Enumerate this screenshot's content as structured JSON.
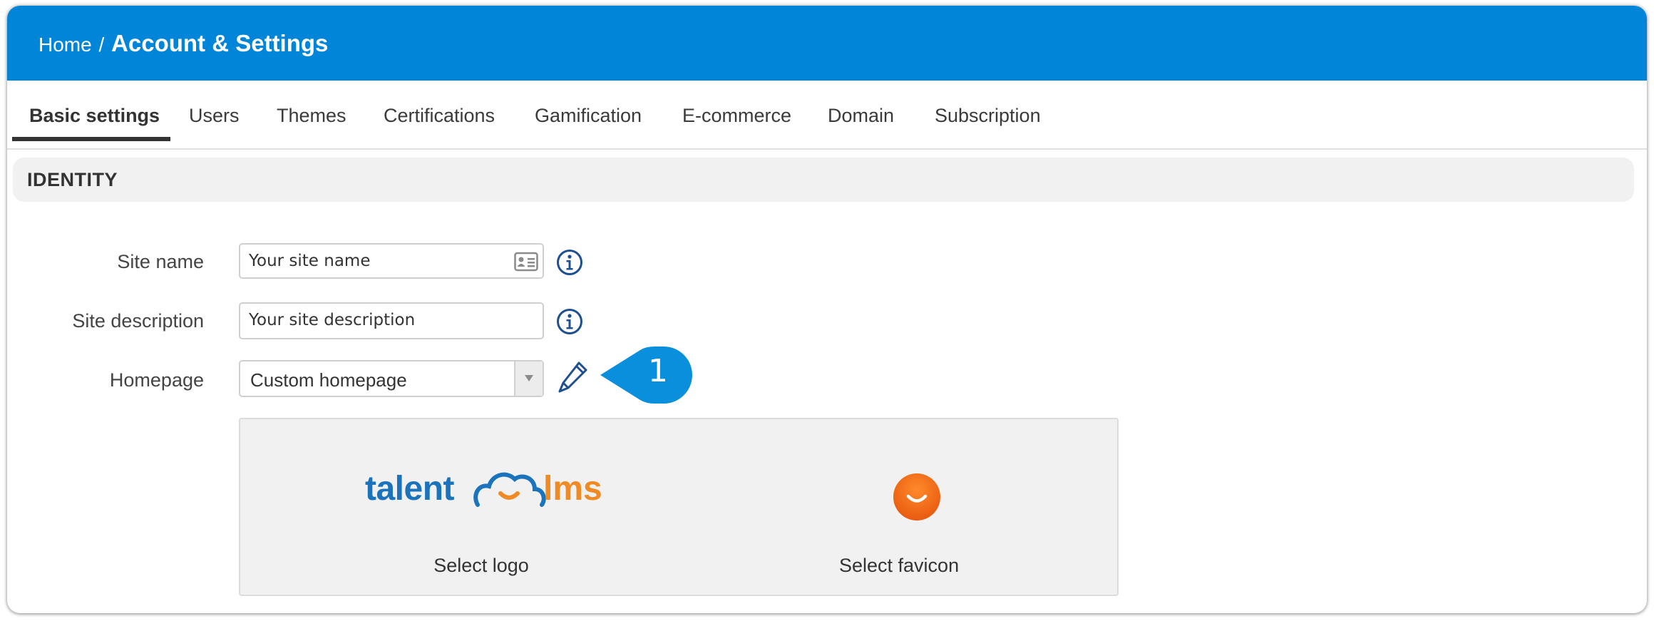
{
  "breadcrumb": {
    "home": "Home",
    "separator": "/",
    "current": "Account & Settings"
  },
  "tabs": [
    {
      "label": "Basic settings",
      "active": true
    },
    {
      "label": "Users"
    },
    {
      "label": "Themes"
    },
    {
      "label": "Certifications"
    },
    {
      "label": "Gamification"
    },
    {
      "label": "E-commerce"
    },
    {
      "label": "Domain"
    },
    {
      "label": "Subscription"
    }
  ],
  "identity": {
    "heading": "IDENTITY",
    "site_name": {
      "label": "Site name",
      "placeholder": "Your site name"
    },
    "site_description": {
      "label": "Site description",
      "placeholder": "Your site description"
    },
    "homepage": {
      "label": "Homepage",
      "value": "Custom homepage"
    },
    "callout_number": "1",
    "logo": {
      "text_left": "talent",
      "text_right": "lms",
      "action": "Select logo"
    },
    "favicon": {
      "action": "Select favicon"
    }
  },
  "colors": {
    "header_blue": "#0085d9",
    "callout_blue": "#0a8fdc",
    "icon_navy": "#1d4f91",
    "logo_blue": "#1b74bb",
    "logo_orange": "#f08a24"
  },
  "icons": [
    "contact-card-icon",
    "info-icon",
    "pencil-icon",
    "dropdown-arrow-icon",
    "favicon-smile-icon"
  ]
}
